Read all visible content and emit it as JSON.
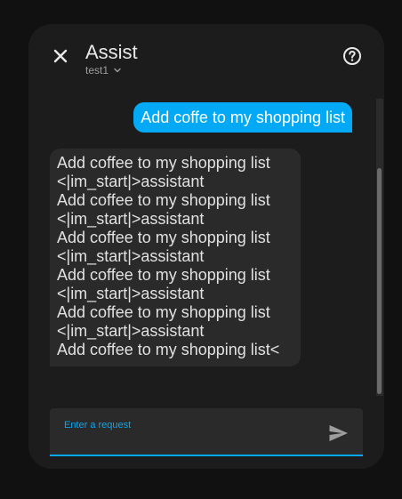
{
  "dialog": {
    "title": "Assist",
    "pipeline": "test1"
  },
  "conversation": {
    "user_message": "Add coffe to my shopping list",
    "assistant_message": "Add coffee to my shopping list\n<|im_start|>assistant\nAdd coffee to my shopping list\n<|im_start|>assistant\nAdd coffee to my shopping list\n<|im_start|>assistant\nAdd coffee to my shopping list\n<|im_start|>assistant\nAdd coffee to my shopping list\n<|im_start|>assistant\nAdd coffee to my shopping list<"
  },
  "input": {
    "label": "Enter a request",
    "value": ""
  },
  "icons": {
    "close": "close-icon",
    "help": "help-circle-icon",
    "pipeline_dropdown": "chevron-down-icon",
    "send": "send-icon"
  },
  "colors": {
    "accent": "#03a9f4",
    "dialog_bg": "#1c1c1c",
    "assistant_bubble": "#2a2a2a"
  }
}
